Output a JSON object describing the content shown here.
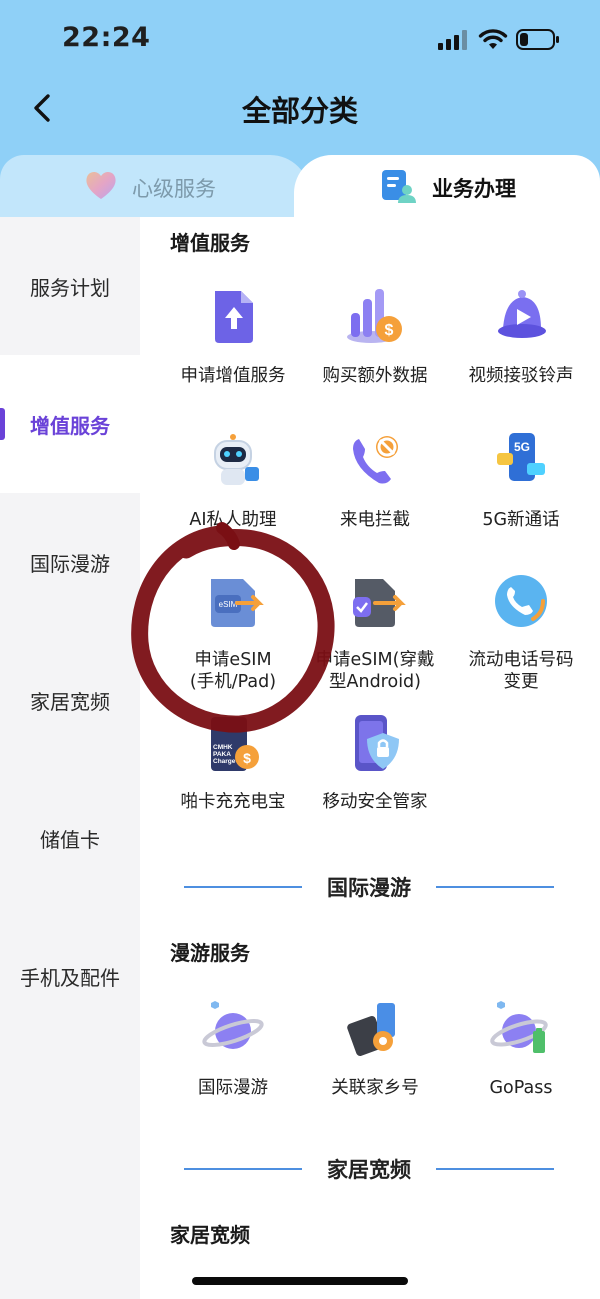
{
  "status": {
    "time": "22:24"
  },
  "header": {
    "title": "全部分类"
  },
  "tabs": [
    {
      "label": "心级服务",
      "active": false
    },
    {
      "label": "业务办理",
      "active": true
    }
  ],
  "sidebar": {
    "items": [
      {
        "label": "服务计划"
      },
      {
        "label": "增值服务",
        "active": true
      },
      {
        "label": "国际漫游"
      },
      {
        "label": "家居宽频"
      },
      {
        "label": "储值卡"
      },
      {
        "label": "手机及配件"
      }
    ]
  },
  "sections": {
    "value_added": {
      "heading": "增值服务",
      "items": [
        {
          "label": "申请增值服务",
          "icon": "upload-doc-icon"
        },
        {
          "label": "购买额外数据",
          "icon": "data-coin-icon"
        },
        {
          "label": "视频接驳铃声",
          "icon": "bell-play-icon"
        },
        {
          "label": "AI私人助理",
          "icon": "robot-icon"
        },
        {
          "label": "来电拦截",
          "icon": "phone-block-icon"
        },
        {
          "label": "5G新通话",
          "icon": "5g-phone-icon"
        },
        {
          "label": "申请eSIM\n(手机/Pad)",
          "line1": "申请eSIM",
          "line2": "(手机/Pad)",
          "icon": "esim-icon"
        },
        {
          "label": "申请eSIM(穿戴型Android)",
          "line1": "申请eSIM(穿戴",
          "line2": "型Android)",
          "icon": "esim-watch-icon"
        },
        {
          "label": "流动电话号码变更",
          "line1": "流动电话号码",
          "line2": "变更",
          "icon": "phone-change-icon"
        },
        {
          "label": "啪卡充充电宝",
          "icon": "powerbank-icon",
          "card_text": "CMHK PAKA Charge"
        },
        {
          "label": "移动安全管家",
          "icon": "phone-shield-icon"
        }
      ]
    },
    "roaming_divider": "国际漫游",
    "roaming": {
      "heading": "漫游服务",
      "items": [
        {
          "label": "国际漫游",
          "icon": "planet-icon"
        },
        {
          "label": "关联家乡号",
          "icon": "sim-card-icon"
        },
        {
          "label": "GoPass",
          "icon": "planet-battery-icon"
        }
      ]
    },
    "broadband_divider": "家居宽频",
    "broadband": {
      "heading": "家居宽频"
    }
  },
  "colors": {
    "accent": "#6a42d8",
    "header_bg": "#8fd0f7",
    "divider": "#4d8fe0",
    "annotation": "#7a0f14"
  }
}
